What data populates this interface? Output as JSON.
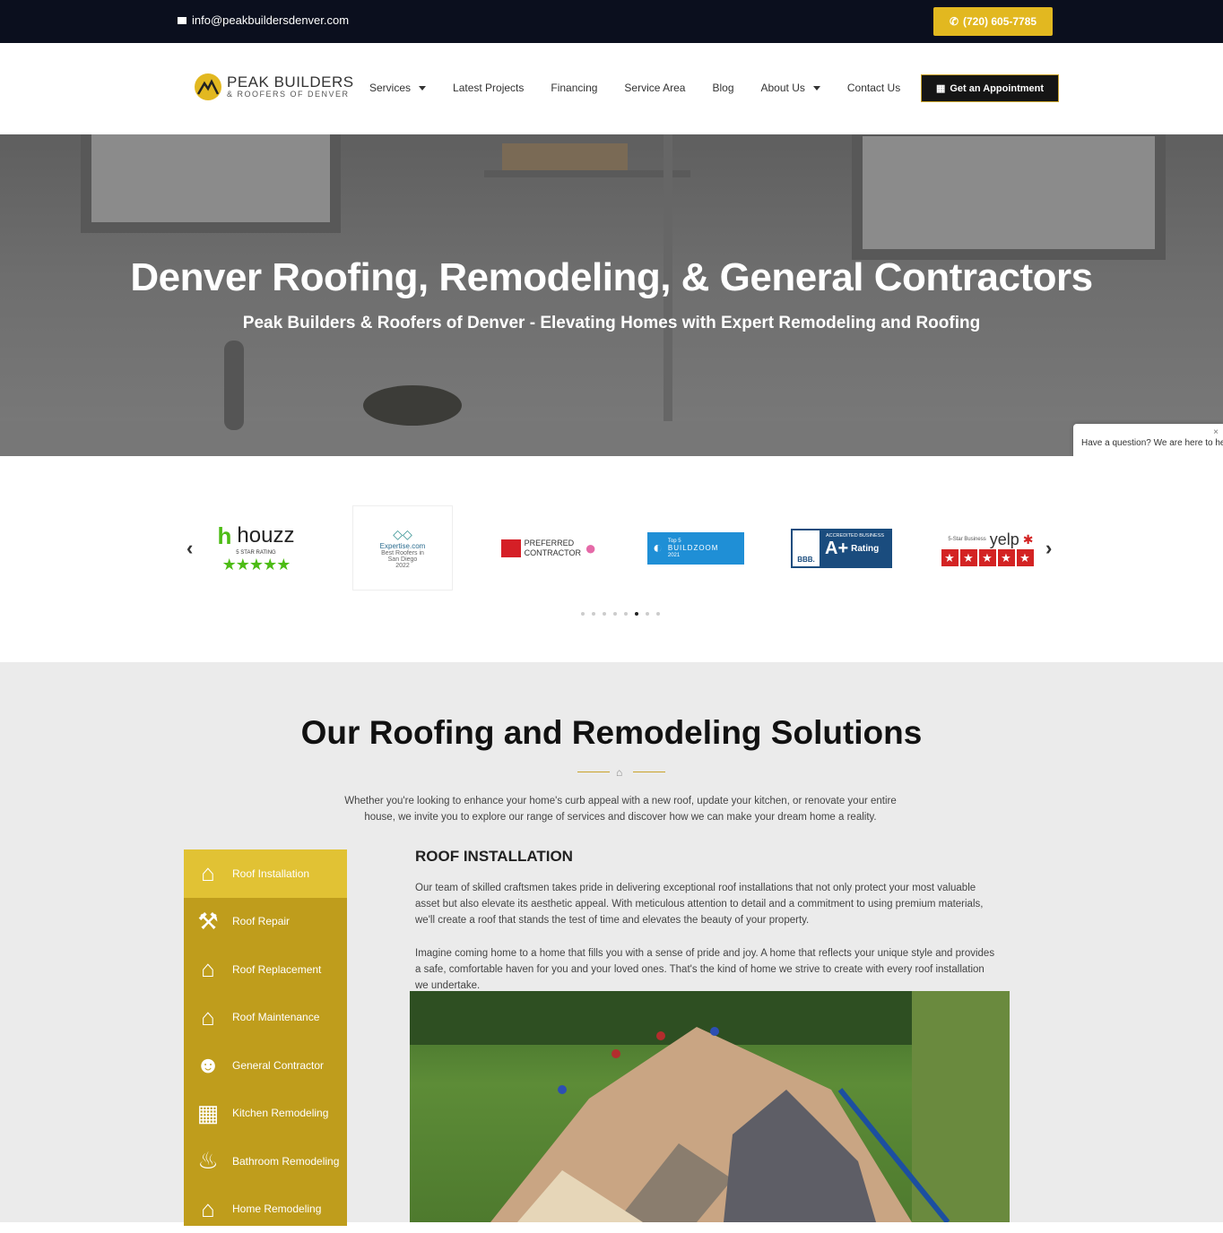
{
  "topbar": {
    "email": "info@peakbuildersdenver.com",
    "phone": "(720) 605-7785"
  },
  "header": {
    "logo_title": "PEAK BUILDERS",
    "logo_subtitle": "& ROOFERS OF DENVER",
    "nav": [
      {
        "label": "Services",
        "has_dropdown": true
      },
      {
        "label": "Latest Projects",
        "has_dropdown": false
      },
      {
        "label": "Financing",
        "has_dropdown": false
      },
      {
        "label": "Service Area",
        "has_dropdown": false
      },
      {
        "label": "Blog",
        "has_dropdown": false
      },
      {
        "label": "About Us",
        "has_dropdown": true
      },
      {
        "label": "Contact Us",
        "has_dropdown": false
      }
    ],
    "cta_label": "Get an Appointment"
  },
  "hero": {
    "title": "Denver Roofing, Remodeling, & General Contractors",
    "subtitle": "Peak Builders & Roofers of Denver - Elevating Homes with Expert Remodeling and Roofing"
  },
  "chat": {
    "text": "Have a question? We are here to help!",
    "close": "×"
  },
  "badges": {
    "houzz": {
      "name": "houzz",
      "caption": "5 STAR RATING"
    },
    "expertise": {
      "name": "Expertise.com",
      "line1": "Best Roofers in",
      "line2": "San Diego",
      "year": "2022"
    },
    "owens": {
      "line1": "PREFERRED",
      "line2": "CONTRACTOR"
    },
    "buildzoom": {
      "small": "Top 5",
      "name": "BUILDZOOM",
      "year": "2021"
    },
    "bbb": {
      "header": "ACCREDITED BUSINESS",
      "logo": "BBB.",
      "grade": "A+",
      "label": "Rating"
    },
    "yelp": {
      "caption": "5-Star Business",
      "name": "yelp"
    },
    "dots_total": 8,
    "dots_active_index": 5
  },
  "solutions": {
    "title": "Our Roofing and Remodeling Solutions",
    "intro": "Whether you're looking to enhance your home's curb appeal with a new roof, update your kitchen, or renovate your entire house, we invite you to explore our range of services and discover how we can make your dream home a reality.",
    "sidebar": [
      {
        "label": "Roof Installation",
        "icon": "roof-installation-icon",
        "active": true
      },
      {
        "label": "Roof Repair",
        "icon": "roof-repair-icon",
        "active": false
      },
      {
        "label": "Roof Replacement",
        "icon": "roof-replacement-icon",
        "active": false
      },
      {
        "label": "Roof Maintenance",
        "icon": "roof-maintenance-icon",
        "active": false
      },
      {
        "label": "General Contractor",
        "icon": "worker-icon",
        "active": false
      },
      {
        "label": "Kitchen Remodeling",
        "icon": "kitchen-icon",
        "active": false
      },
      {
        "label": "Bathroom Remodeling",
        "icon": "bathtub-icon",
        "active": false
      },
      {
        "label": "Home Remodeling",
        "icon": "house-icon",
        "active": false
      }
    ],
    "content": {
      "title": "ROOF INSTALLATION",
      "para1": "Our team of skilled craftsmen takes pride in delivering exceptional roof installations that not only protect your most valuable asset but also elevate its aesthetic appeal. With meticulous attention to detail and a commitment to using premium materials, we'll create a roof that stands the test of time and elevates the beauty of your property.",
      "para2": "Imagine coming home to a home that fills you with a sense of pride and joy. A home that reflects your unique style and provides a safe, comfortable haven for you and your loved ones. That's the kind of home we strive to create with every roof installation we undertake."
    }
  },
  "colors": {
    "topbar": "#0b0f1e",
    "accent": "#e2b820",
    "sidebar": "#bf9d1c",
    "sidebar_active": "#e1c234",
    "section_bg": "#ebebeb"
  }
}
